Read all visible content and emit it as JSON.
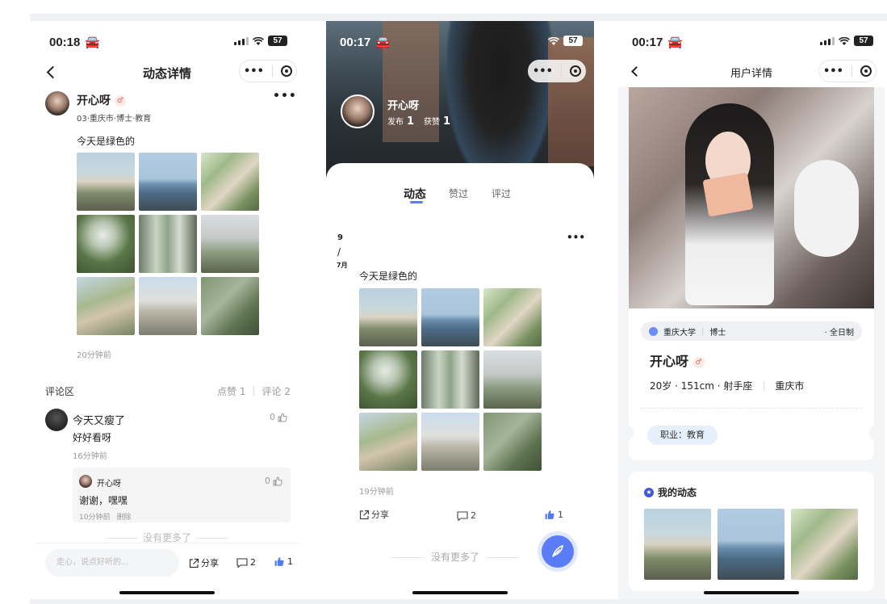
{
  "p1": {
    "time": "00:18",
    "battery": "57",
    "nav_title": "动态详情",
    "author": {
      "name": "开心呀",
      "meta": "03·重庆市·博士·教育"
    },
    "post_text": "今天是绿色的",
    "post_time": "20分钟前",
    "comments_header": {
      "title": "评论区",
      "likes": "点赞 1",
      "comments": "评论 2"
    },
    "comment": {
      "name": "今天又瘦了",
      "text": "好好看呀",
      "time": "16分钟前",
      "likes": "0"
    },
    "reply": {
      "name": "开心呀",
      "text": "谢谢，嘿嘿",
      "time": "10分钟前",
      "delete": "删除",
      "likes": "0"
    },
    "no_more": "没有更多了",
    "input_placeholder": "走心，说点好听的...",
    "share": "分享",
    "comment_count": "2",
    "like_count": "1"
  },
  "p2": {
    "time": "00:17",
    "battery": "57",
    "name": "开心呀",
    "publish_label": "发布",
    "publish_count": "1",
    "liked_label": "获赞",
    "liked_count": "1",
    "tabs": [
      "动态",
      "赞过",
      "评过"
    ],
    "date_day": "9",
    "date_sep": "/",
    "date_month": "7月",
    "post_text": "今天是绿色的",
    "post_time": "19分钟前",
    "share": "分享",
    "comment_count": "2",
    "like_count": "1",
    "no_more": "没有更多了"
  },
  "p3": {
    "time": "00:17",
    "battery": "57",
    "nav_title": "用户详情",
    "school": "重庆大学",
    "degree": "博士",
    "study_mode": "· 全日制",
    "name": "开心呀",
    "info": "20岁 · 151cm · 射手座",
    "city": "重庆市",
    "job": "职业：教育",
    "my_posts": "我的动态"
  },
  "colors": {
    "accent": "#5b7cf7",
    "like_blue": "#4f78f5",
    "muted": "#999999"
  }
}
